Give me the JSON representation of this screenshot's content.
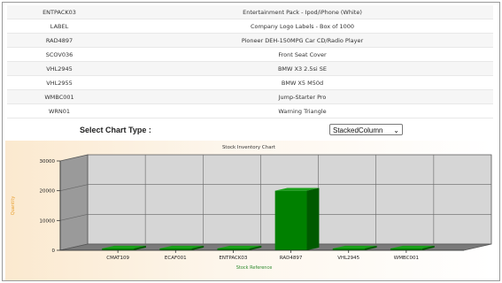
{
  "stock_table": {
    "rows": [
      {
        "code": "ENTPACK03",
        "description": "Entertainment Pack - Ipod/iPhone (White)"
      },
      {
        "code": "LABEL",
        "description": "Company Logo Labels - Box of 1000"
      },
      {
        "code": "RAD4897",
        "description": "Pioneer DEH-150MPG Car CD/Radio Player"
      },
      {
        "code": "SCOV036",
        "description": "Front Seat Cover"
      },
      {
        "code": "VHL2945",
        "description": "BMW X3 2.5si SE"
      },
      {
        "code": "VHL2955",
        "description": "BMW X5 M50d"
      },
      {
        "code": "WMBC001",
        "description": "Jump-Starter Pro"
      },
      {
        "code": "WRN01",
        "description": "Warning Triangle"
      }
    ]
  },
  "chart_selector": {
    "label": "Select Chart Type :",
    "selected": "StackedColumn"
  },
  "icons": {
    "dropdown": "chevron-down-icon"
  },
  "colors": {
    "bar": "#008000",
    "bar_dark": "#005a00",
    "bar_light": "#19a019",
    "panel_bg": "#fdf3e3",
    "plot_face": "#d6d6d6",
    "ylabel": "#e8a030",
    "xlabel": "#2e8b2e"
  },
  "chart_data": {
    "type": "bar",
    "title": "Stock Inventory Chart",
    "xlabel": "Stock Reference",
    "ylabel": "Quantity",
    "categories": [
      "CMAT109",
      "ECAF001",
      "ENTPACK03",
      "RAD4897",
      "VHL2945",
      "WMBC001"
    ],
    "values": [
      0,
      0,
      0,
      20000,
      0,
      0
    ],
    "ylim": [
      0,
      30000
    ],
    "yticks": [
      0,
      10000,
      20000,
      30000
    ],
    "grid": true,
    "style": "3d"
  }
}
